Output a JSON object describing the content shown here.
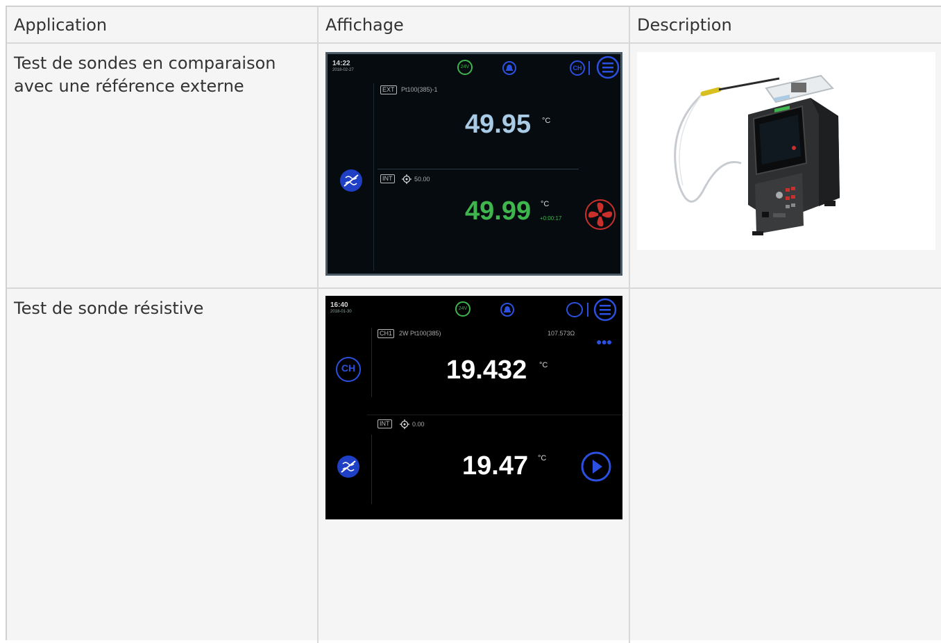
{
  "headers": {
    "application": "Application",
    "affichage": "Affichage",
    "description": "Description"
  },
  "rows": [
    {
      "application": "Test de sondes en comparaison avec une référence externe",
      "screen": {
        "time": "14:22",
        "date": "2018-02-27",
        "supply": "24V",
        "ext_tag": "EXT",
        "ext_label": "Pt100(385)-1",
        "ext_value": "49.95",
        "int_tag": "INT",
        "setpoint": "50.00",
        "int_value": "49.99",
        "unit": "°C",
        "timer": "+0:00:17",
        "ch_label": "CH",
        "colors": {
          "ext_value": "#a9cbe6",
          "int_value": "#3fb54d",
          "accent": "#2b50e0",
          "fan": "#c9302c"
        }
      }
    },
    {
      "application": "Test de sonde résistive",
      "screen": {
        "time": "16:40",
        "date": "2018-01-30",
        "supply": "24V",
        "ch_tag": "CH1",
        "ch_label": "2W Pt100(385)",
        "resistance": "107.573Ω",
        "ch_value": "19.432",
        "int_tag": "INT",
        "setpoint": "0.00",
        "int_value": "19.47",
        "unit": "°C",
        "ch_icon_label": "CH",
        "colors": {
          "value": "#ffffff",
          "accent": "#2b50e0"
        }
      }
    }
  ]
}
